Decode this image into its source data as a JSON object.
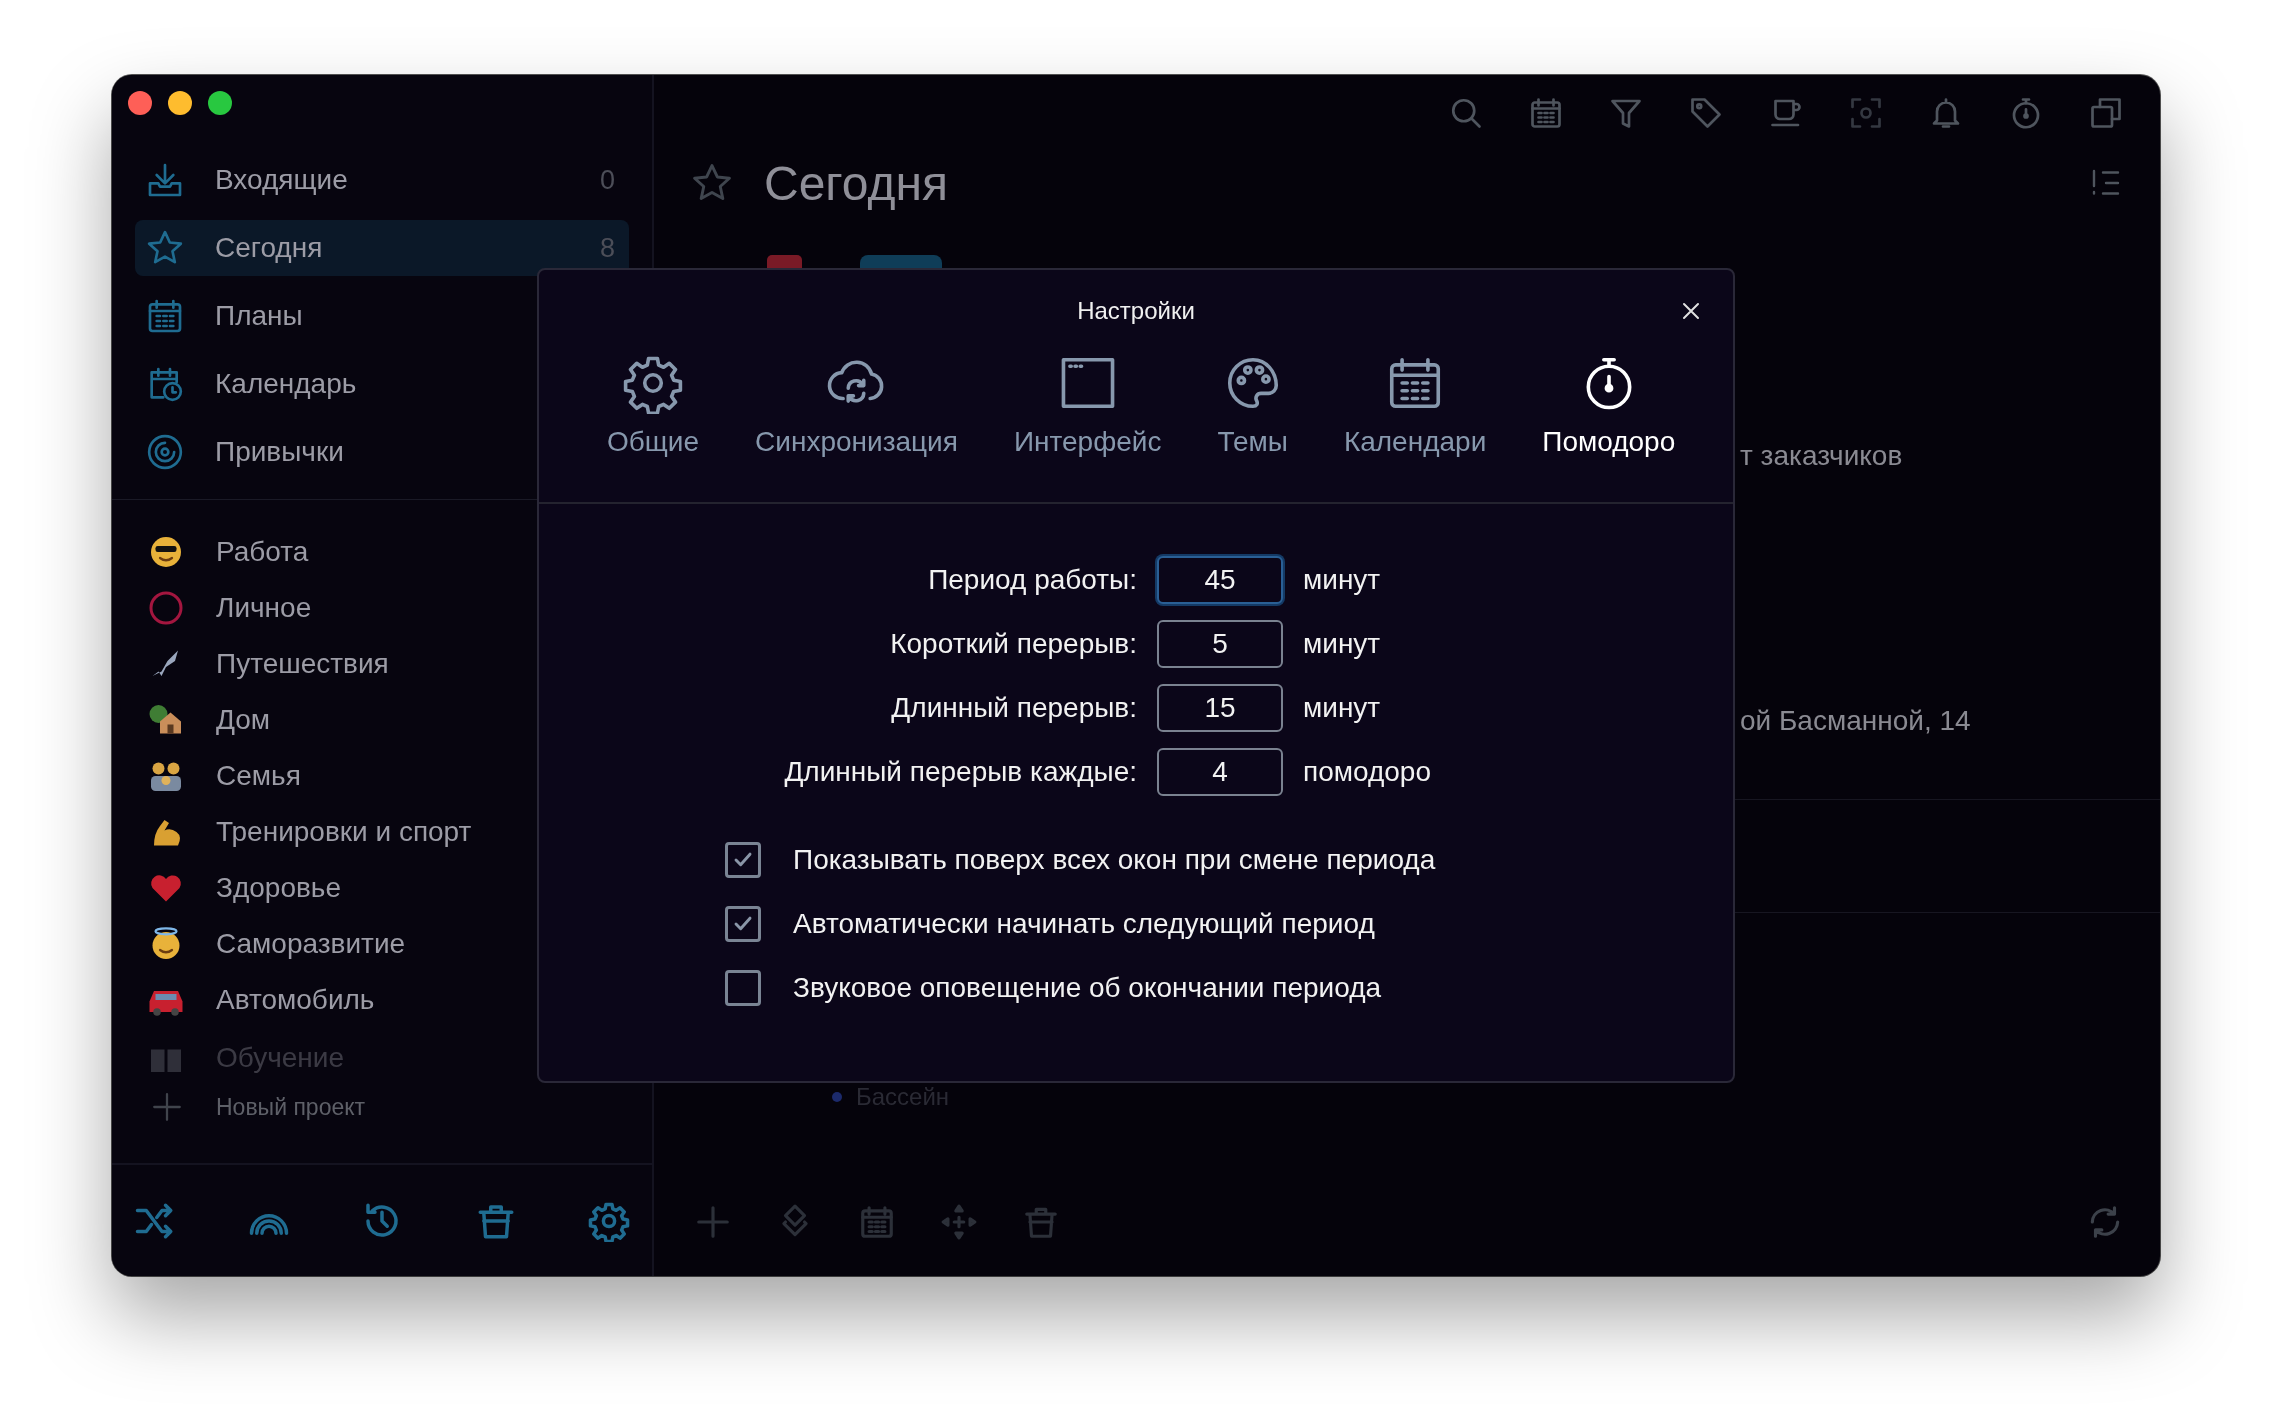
{
  "sidebar": {
    "nav": [
      {
        "label": "Входящие",
        "count": "0",
        "selected": false
      },
      {
        "label": "Сегодня",
        "count": "8",
        "selected": true
      },
      {
        "label": "Планы",
        "selected": false
      },
      {
        "label": "Календарь",
        "selected": false
      },
      {
        "label": "Привычки",
        "selected": false
      }
    ],
    "projects": [
      {
        "label": "Работа",
        "faded": false
      },
      {
        "label": "Личное",
        "faded": false
      },
      {
        "label": "Путешествия",
        "faded": false
      },
      {
        "label": "Дом",
        "faded": false
      },
      {
        "label": "Семья",
        "faded": false
      },
      {
        "label": "Тренировки и спорт",
        "faded": false
      },
      {
        "label": "Здоровье",
        "faded": false
      },
      {
        "label": "Саморазвитие",
        "faded": false
      },
      {
        "label": "Автомобиль",
        "faded": false
      },
      {
        "label": "Обучение",
        "faded": true
      }
    ],
    "new_project": "Новый проект"
  },
  "main": {
    "title": "Сегодня",
    "task_fragments": [
      "т заказчиков",
      "ой Басманной, 14"
    ],
    "subtask": "Бассейн"
  },
  "dialog": {
    "title": "Настройки",
    "tabs": [
      {
        "label": "Общие",
        "selected": false
      },
      {
        "label": "Синхронизация",
        "selected": false
      },
      {
        "label": "Интерфейс",
        "selected": false
      },
      {
        "label": "Темы",
        "selected": false
      },
      {
        "label": "Календари",
        "selected": false
      },
      {
        "label": "Помодоро",
        "selected": true
      }
    ],
    "fields": [
      {
        "label": "Период работы:",
        "value": "45",
        "unit": "минут",
        "focused": true
      },
      {
        "label": "Короткий перерыв:",
        "value": "5",
        "unit": "минут",
        "focused": false
      },
      {
        "label": "Длинный перерыв:",
        "value": "15",
        "unit": "минут",
        "focused": false
      },
      {
        "label": "Длинный перерыв каждые:",
        "value": "4",
        "unit": "помодоро",
        "focused": false
      }
    ],
    "options": [
      {
        "label": "Показывать поверх всех окон при смене периода",
        "checked": true
      },
      {
        "label": "Автоматически начинать следующий период",
        "checked": true
      },
      {
        "label": "Звуковое оповещение об окончании периода",
        "checked": false
      }
    ]
  }
}
